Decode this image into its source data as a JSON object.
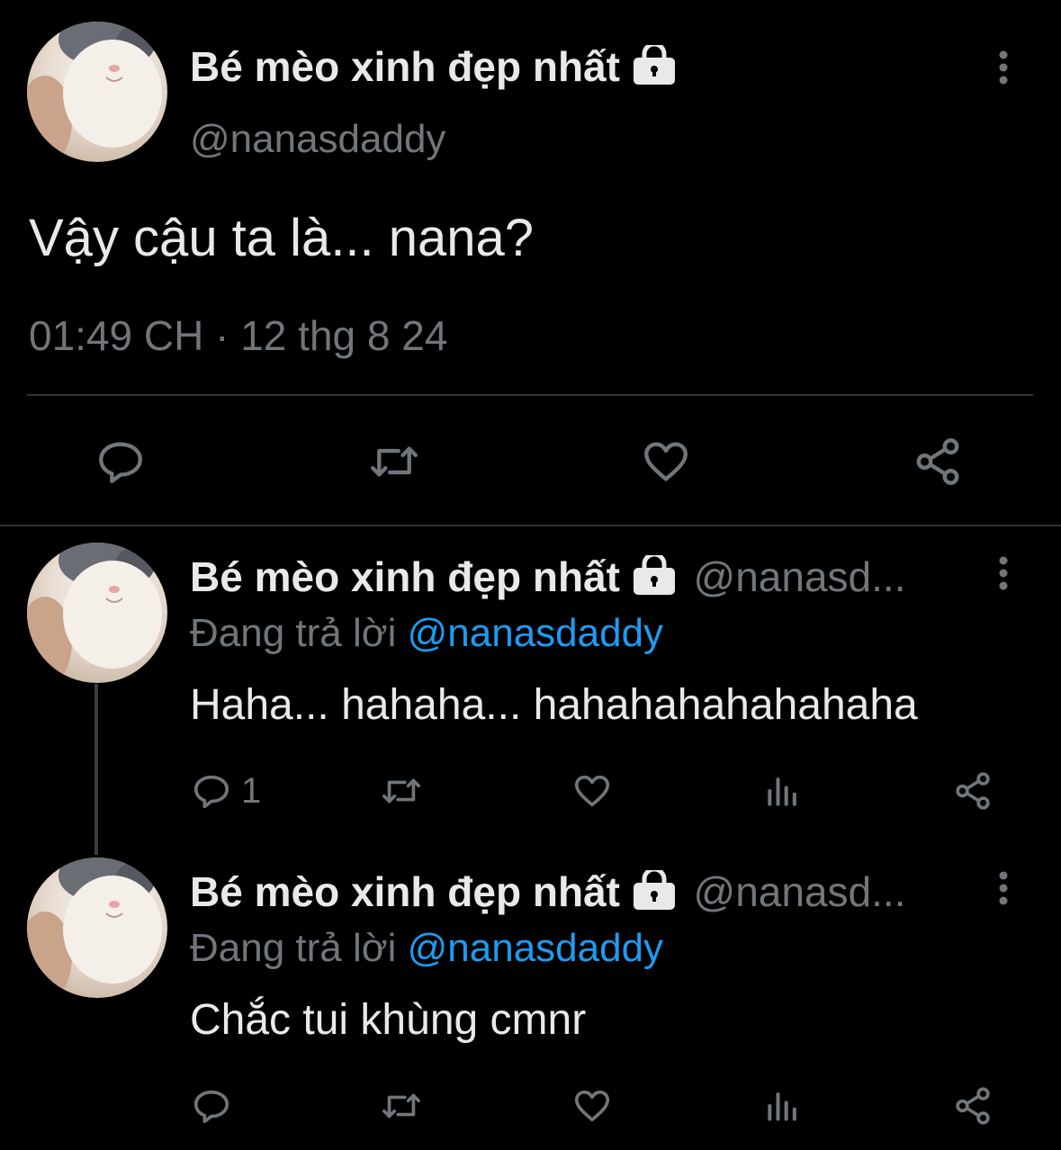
{
  "main_tweet": {
    "display_name": "Bé mèo xinh đẹp nhất",
    "handle": "@nanasdaddy",
    "text": "Vậy cậu ta là... nana?",
    "timestamp": "01:49 CH · 12 thg 8 24"
  },
  "replies": [
    {
      "display_name": "Bé mèo xinh đẹp nhất",
      "handle_truncated": "@nanasd...",
      "replying_prefix": "Đang trả lời",
      "replying_to": "@nanasdaddy",
      "text": "Haha... hahaha... hahahahahahahaha",
      "reply_count": "1"
    },
    {
      "display_name": "Bé mèo xinh đẹp nhất",
      "handle_truncated": "@nanasd...",
      "replying_prefix": "Đang trả lời",
      "replying_to": "@nanasdaddy",
      "text": "Chắc tui khùng cmnr",
      "reply_count": ""
    }
  ],
  "colors": {
    "background": "#000000",
    "text": "#e7e9ea",
    "muted": "#71767b",
    "accent": "#1d9bf0",
    "divider": "#2f3336"
  },
  "icons": [
    "lock-icon",
    "more-options-icon",
    "reply-icon",
    "retweet-icon",
    "like-icon",
    "share-icon",
    "views-icon"
  ]
}
